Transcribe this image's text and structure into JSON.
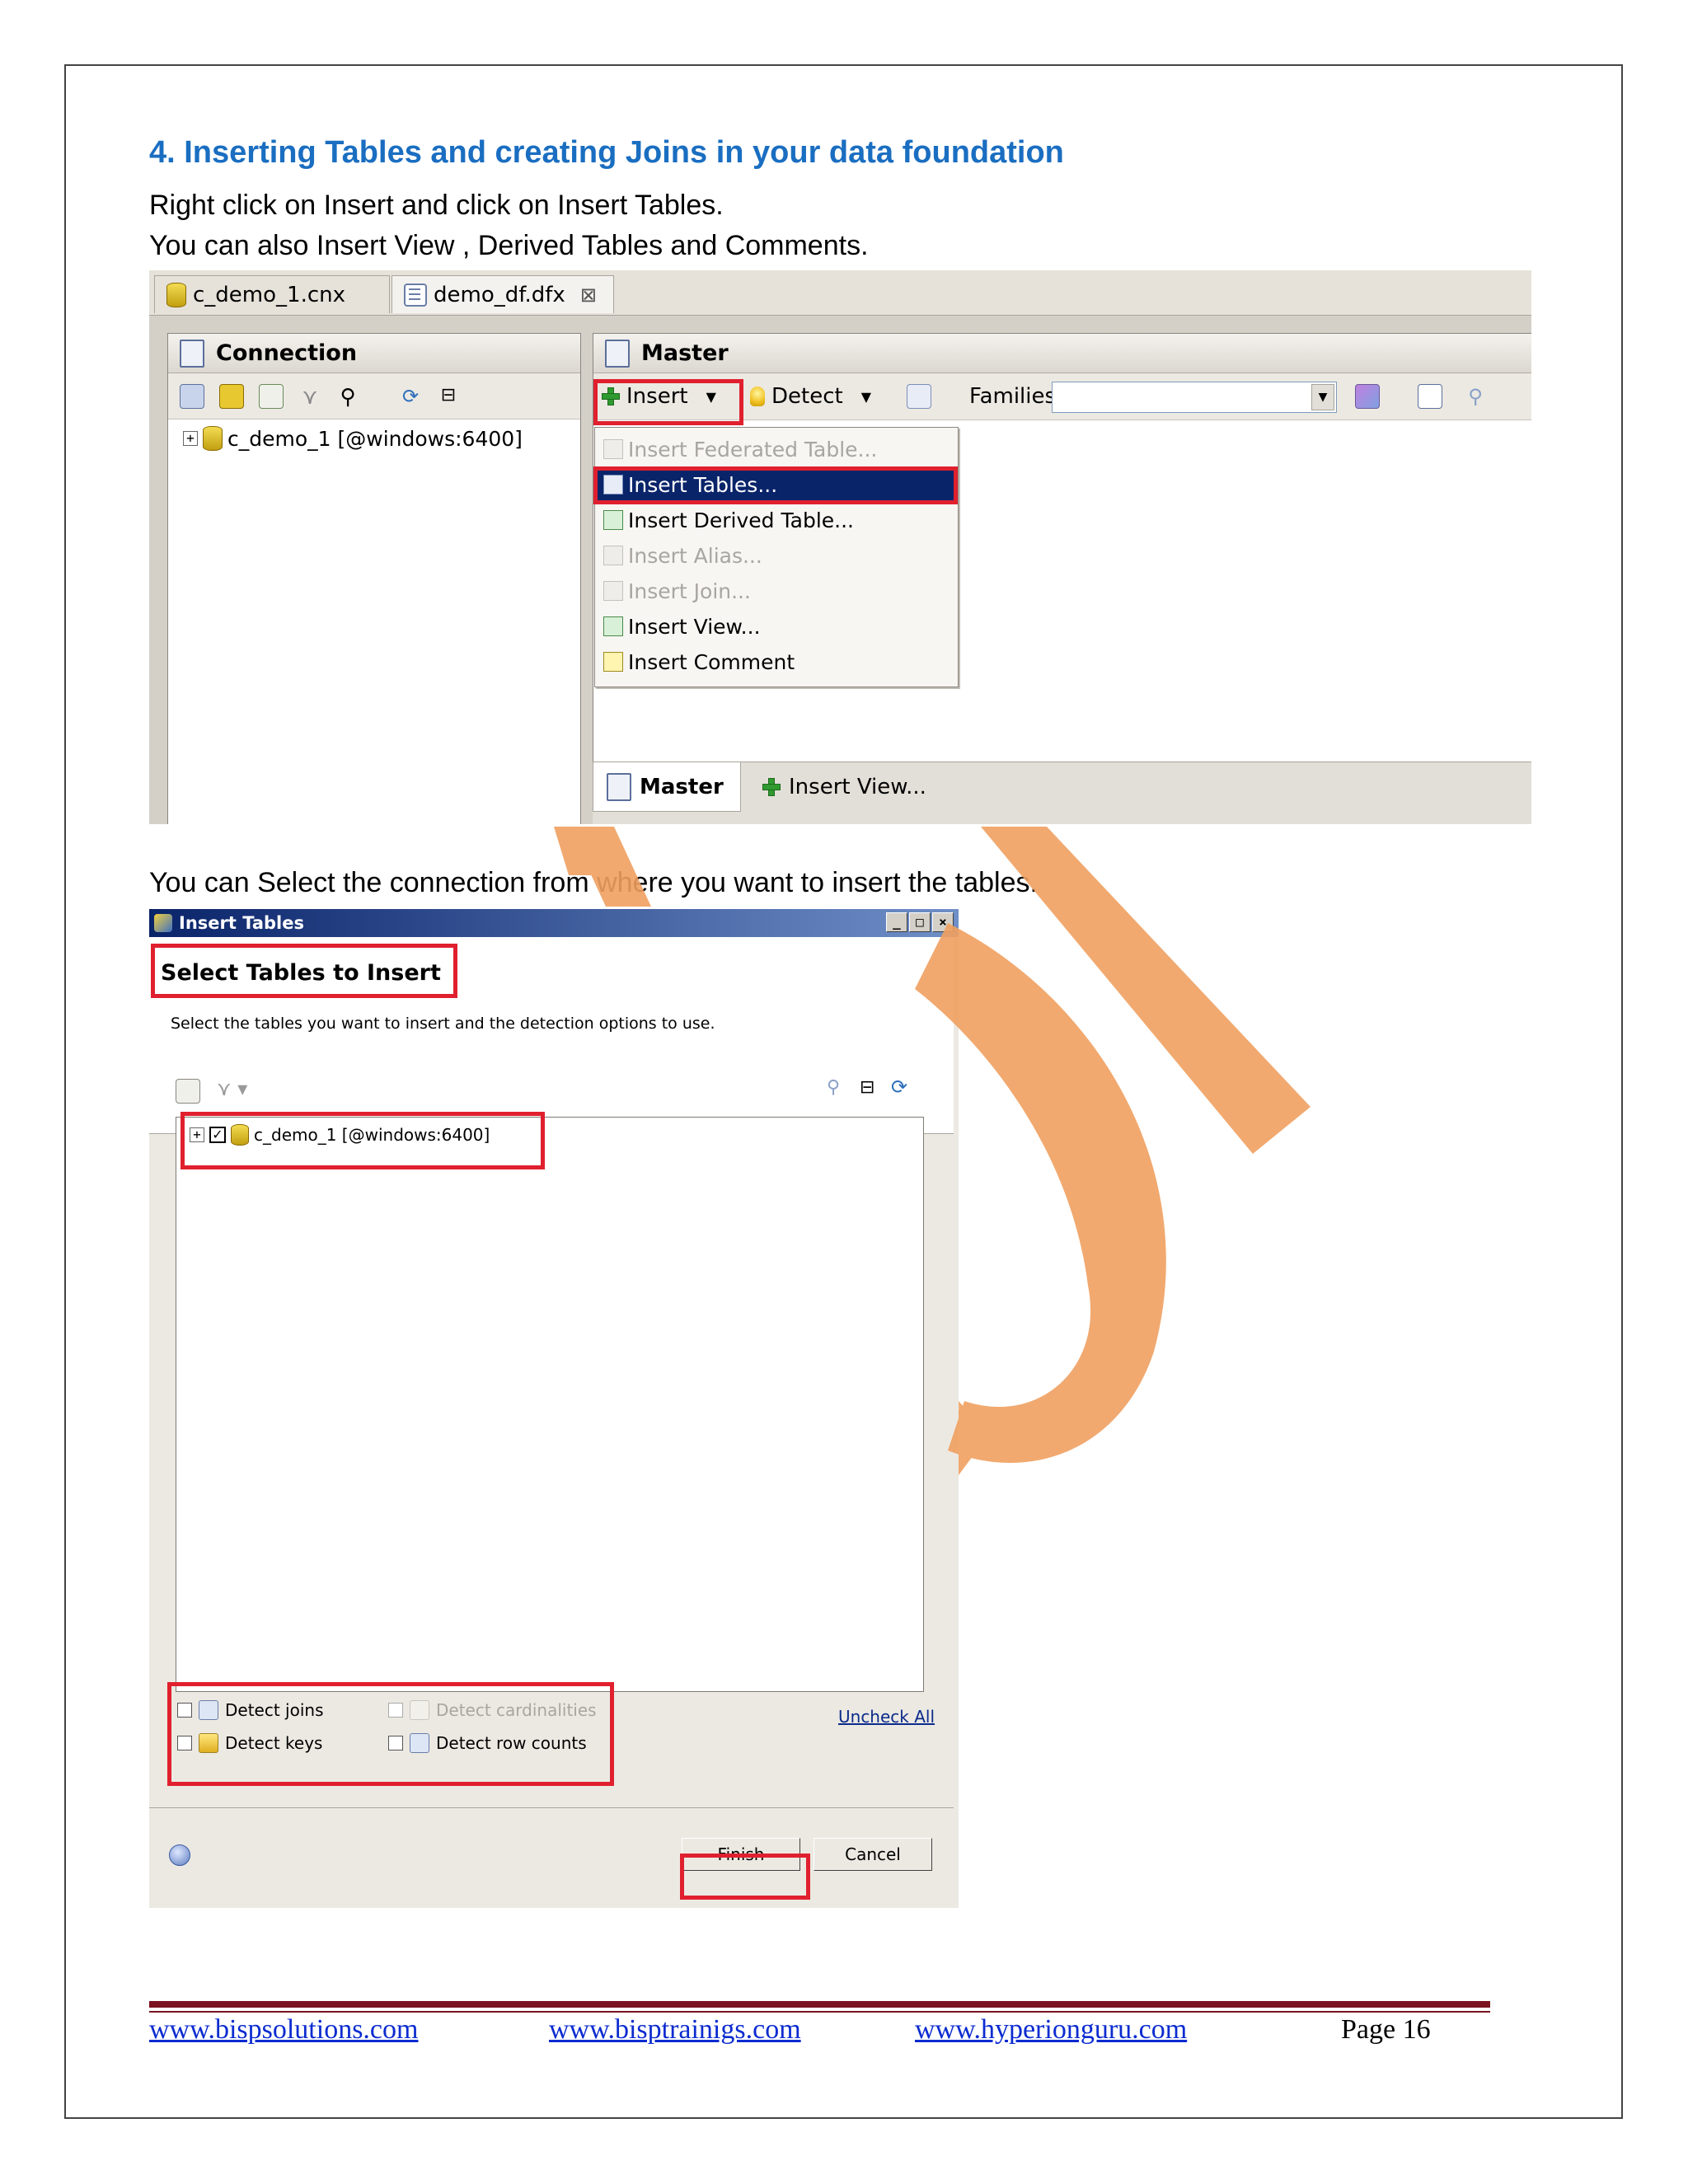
{
  "heading": "4. Inserting Tables and creating Joins in your data foundation",
  "para1": "Right click on Insert and click on Insert Tables.",
  "para2": "You can also Insert View , Derived Tables and Comments.",
  "para3": "You can Select the connection from where you want to insert the tables.",
  "screenshot1": {
    "editor_tabs": [
      "c_demo_1.cnx",
      "demo_df.dfx"
    ],
    "connection_pane_title": "Connection",
    "connection_tree_item": "c_demo_1 [@windows:6400]",
    "master_pane_title": "Master",
    "toolbar": {
      "insert": "Insert",
      "detect": "Detect",
      "families_label": "Families",
      "families_value": ""
    },
    "insert_menu": [
      {
        "label": "Insert Federated Table...",
        "state": "disabled"
      },
      {
        "label": "Insert Tables...",
        "state": "selected"
      },
      {
        "label": "Insert Derived Table...",
        "state": "enabled"
      },
      {
        "label": "Insert Alias...",
        "state": "disabled"
      },
      {
        "label": "Insert Join...",
        "state": "disabled"
      },
      {
        "label": "Insert View...",
        "state": "enabled"
      },
      {
        "label": "Insert Comment",
        "state": "enabled"
      }
    ],
    "bottom_tabs": [
      "Master",
      "Insert View..."
    ],
    "highlight_color": "#e0202e",
    "selection_color": "#0a246a"
  },
  "screenshot2": {
    "window_title": "Insert Tables",
    "window_buttons": [
      "_",
      "□",
      "×"
    ],
    "banner_title": "Select Tables to Insert",
    "banner_desc": "Select the tables you want to insert and the detection options to use.",
    "tree_item": "c_demo_1 [@windows:6400]",
    "tree_item_checked": true,
    "options": [
      {
        "label": "Detect joins",
        "checked": false,
        "enabled": true
      },
      {
        "label": "Detect cardinalities",
        "checked": false,
        "enabled": false
      },
      {
        "label": "Detect keys",
        "checked": false,
        "enabled": true
      },
      {
        "label": "Detect row counts",
        "checked": false,
        "enabled": true
      }
    ],
    "uncheck_all": "Uncheck All",
    "finish_button": "Finish",
    "cancel_button": "Cancel"
  },
  "footer": {
    "links": [
      "www.bispsolutions.com",
      "www.bisptrainigs.com",
      "www.hyperionguru.com"
    ],
    "page": "Page 16",
    "rule_color": "#7a1220",
    "link_color": "#0b2bd0"
  },
  "watermark_color": "#f0a060"
}
